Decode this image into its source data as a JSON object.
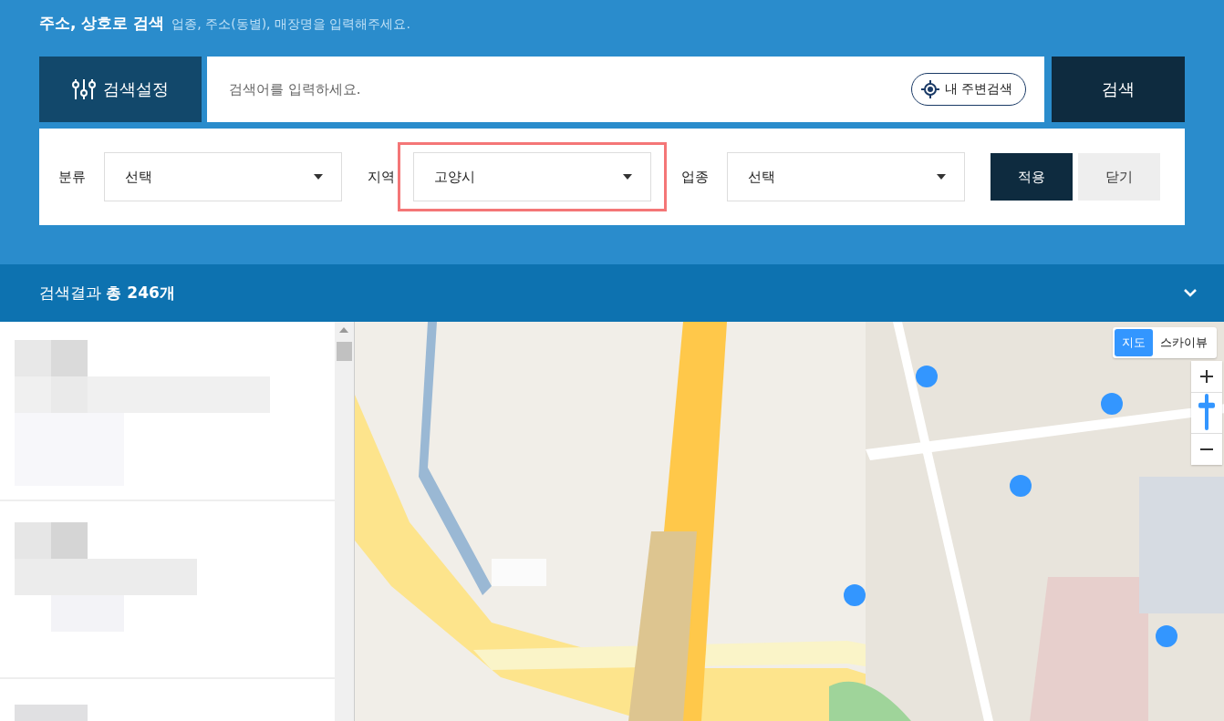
{
  "header": {
    "title": "주소, 상호로 검색",
    "hint": "업종, 주소(동별), 매장명을 입력해주세요."
  },
  "search": {
    "settings_button": "검색설정",
    "placeholder": "검색어를 입력하세요.",
    "nearby_button": "내 주변검색",
    "search_button": "검색"
  },
  "filters": [
    {
      "label": "분류",
      "value": "선택",
      "highlighted": false
    },
    {
      "label": "지역",
      "value": "고양시",
      "highlighted": true
    },
    {
      "label": "업종",
      "value": "선택",
      "highlighted": false
    }
  ],
  "filter_buttons": [
    {
      "label": "적용",
      "kind": "primary"
    },
    {
      "label": "닫기",
      "kind": "secondary"
    }
  ],
  "results": {
    "title": "검색결과 **총 246개**"
  },
  "map": {
    "zoom": {
      "level": 0.7
    },
    "map_types": [
      {
        "label": "지도",
        "selected": true
      },
      {
        "label": "스카이뷰",
        "selected": false
      }
    ]
  }
}
